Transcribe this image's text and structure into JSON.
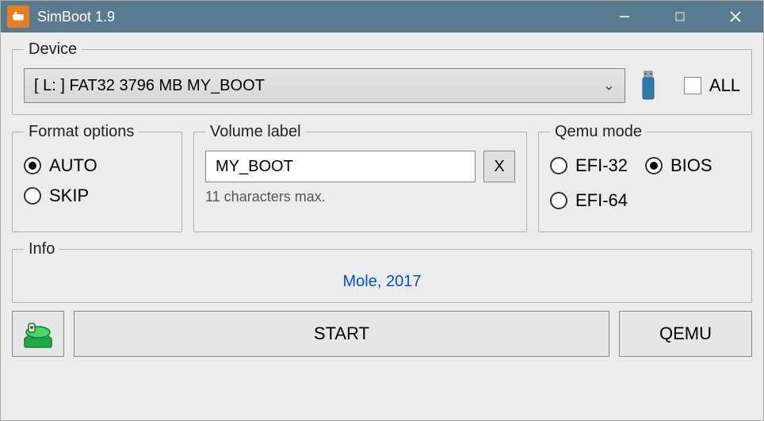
{
  "titlebar": {
    "title": "SimBoot 1.9"
  },
  "device": {
    "legend": "Device",
    "selected": "[ L: ]   FAT32   3796 MB   MY_BOOT",
    "all_label": "ALL",
    "all_checked": false
  },
  "format_options": {
    "legend": "Format options",
    "option_auto": "AUTO",
    "option_skip": "SKIP",
    "selected": "AUTO"
  },
  "volume_label": {
    "legend": "Volume label",
    "value": "MY_BOOT",
    "clear_label": "X",
    "hint": "11 characters max."
  },
  "qemu_mode": {
    "legend": "Qemu mode",
    "option_efi32": "EFI-32",
    "option_efi64": "EFI-64",
    "option_bios": "BIOS",
    "selected": "BIOS"
  },
  "info": {
    "legend": "Info",
    "text": "Mole, 2017"
  },
  "buttons": {
    "start": "START",
    "qemu": "QEMU"
  }
}
